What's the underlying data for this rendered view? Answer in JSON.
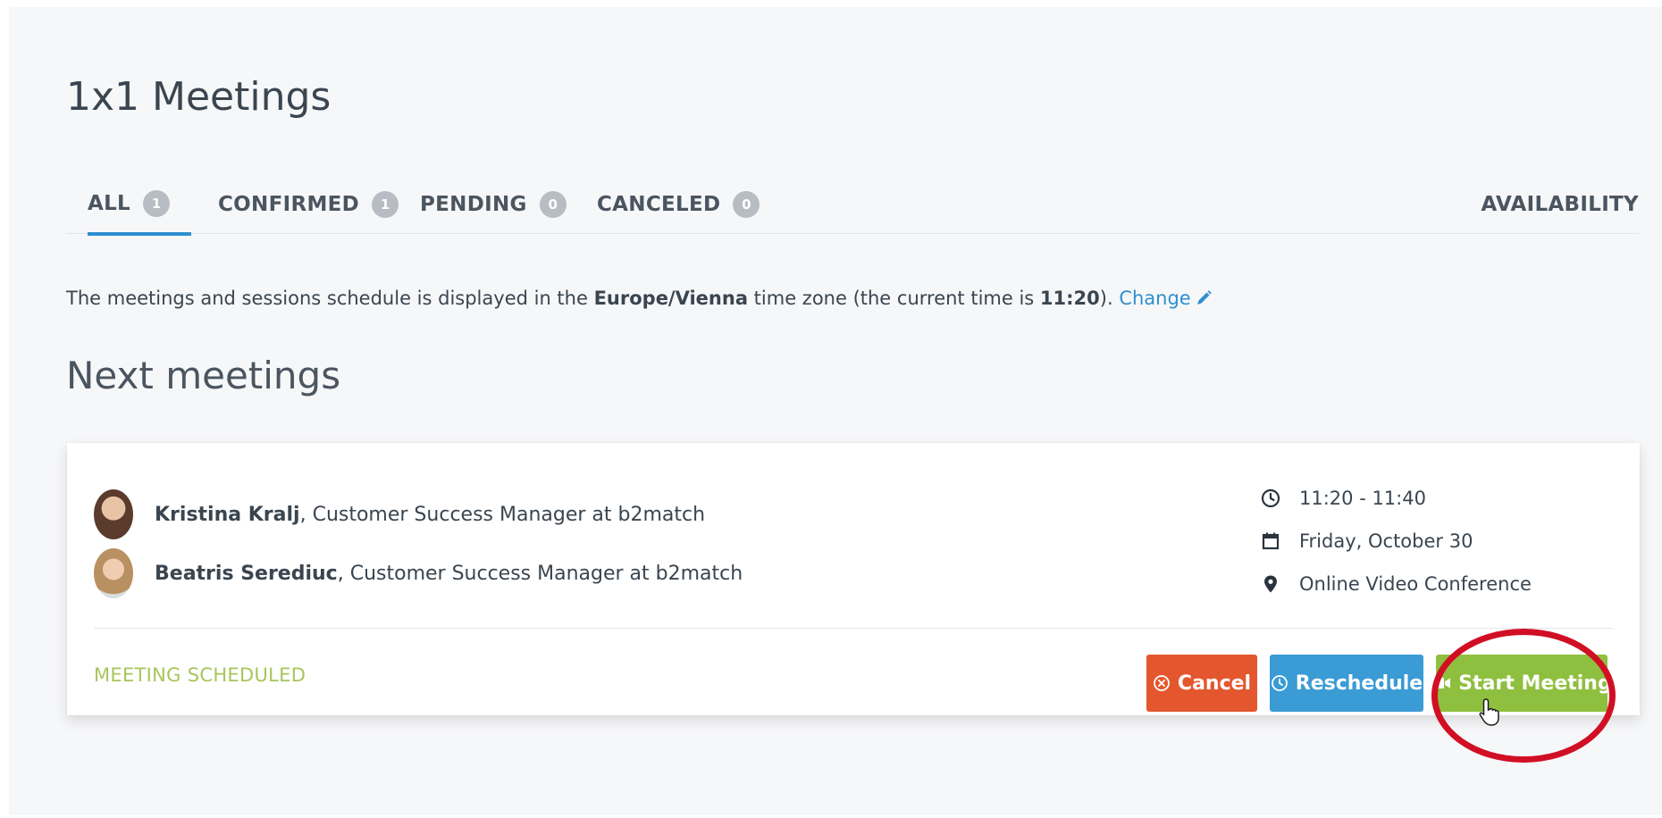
{
  "page": {
    "title": "1x1 Meetings",
    "subtitle": "Next meetings"
  },
  "tabs": [
    {
      "label": "ALL",
      "count": "1",
      "active": true
    },
    {
      "label": "CONFIRMED",
      "count": "1"
    },
    {
      "label": "PENDING",
      "count": "0"
    },
    {
      "label": "CANCELED",
      "count": "0"
    }
  ],
  "availability_label": "AVAILABILITY",
  "timezone": {
    "prefix": "The meetings and sessions schedule is displayed in the ",
    "zone": "Europe/Vienna",
    "middle": " time zone (the current time is ",
    "time": "11:20",
    "suffix": "). ",
    "change_label": "Change"
  },
  "meeting": {
    "participants": [
      {
        "name": "Kristina Kralj",
        "role": ", Customer Success Manager at b2match"
      },
      {
        "name": "Beatris Serediuc",
        "role": ", Customer Success Manager at b2match"
      }
    ],
    "time": "11:20 - 11:40",
    "date": "Friday, October 30",
    "location": "Online Video Conference",
    "status": "MEETING SCHEDULED",
    "actions": {
      "cancel": "Cancel",
      "reschedule": "Reschedule",
      "start": "Start Meeting"
    }
  },
  "colors": {
    "accent": "#2f8fd0",
    "cancel": "#e4572e",
    "reschedule": "#3a9bd5",
    "start": "#8fbf3f",
    "status": "#a8c55a",
    "highlight": "#d10f24"
  },
  "icons": [
    "clock-icon",
    "calendar-icon",
    "location-pin-icon",
    "pencil-icon",
    "cancel-circle-icon",
    "video-camera-icon",
    "hand-cursor-icon"
  ]
}
